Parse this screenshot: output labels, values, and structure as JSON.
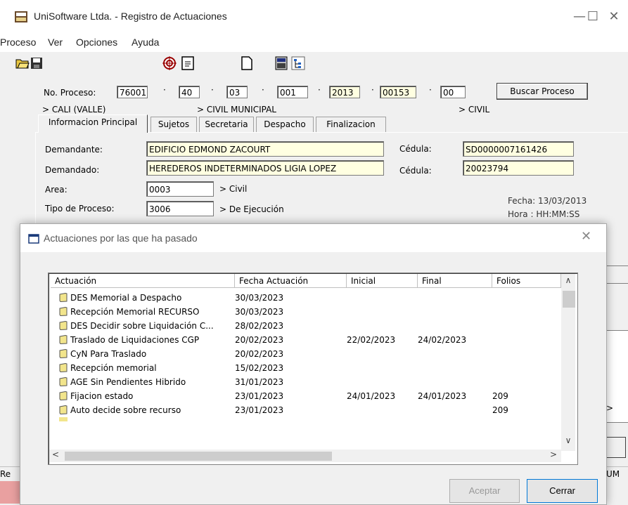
{
  "window": {
    "title": "UniSoftware Ltda. - Registro de Actuaciones",
    "minimize": "—",
    "maximize": "☐",
    "close": "✕"
  },
  "menu": [
    "Proceso",
    "Ver",
    "Opciones",
    "Ayuda"
  ],
  "process": {
    "label": "No. Proceso:",
    "segments": [
      "76001",
      "40",
      "03",
      "001",
      "2013",
      "00153",
      "00"
    ],
    "search_button": "Buscar Proceso",
    "location": "> CALI (VALLE)",
    "court": "> CIVIL MUNICIPAL",
    "speciality": "> CIVIL"
  },
  "tabs": [
    "Informacion Principal",
    "Sujetos",
    "Secretaria",
    "Despacho",
    "Finalizacion"
  ],
  "main": {
    "demandante_label": "Demandante:",
    "demandante": "EDIFICIO EDMOND ZACOURT",
    "cedula_label": "Cédula:",
    "cedula1": "SD0000007161426",
    "demandado_label": "Demandado:",
    "demandado": "HEREDEROS INDETERMINADOS LIGIA LOPEZ",
    "cedula2": "20023794",
    "area_label": "Area:",
    "area": "0003",
    "area_desc": "> Civil",
    "tipo_label": "Tipo de Proceso:",
    "tipo": "3006",
    "tipo_desc": "> De Ejecución",
    "fecha": "Fecha:  13/03/2013",
    "hora": "Hora :  HH:MM:SS"
  },
  "status": {
    "left": "Re",
    "right": "UM"
  },
  "modal": {
    "title": "Actuaciones por las que ha pasado",
    "close": "✕",
    "columns": [
      "Actuación",
      "Fecha Actuación",
      "Inicial",
      "Final",
      "Folios"
    ],
    "rows": [
      [
        "DES Memorial a Despacho",
        "30/03/2023",
        "",
        "",
        ""
      ],
      [
        "Recepción Memorial RECURSO",
        "30/03/2023",
        "",
        "",
        ""
      ],
      [
        "DES Decidir sobre Liquidación C...",
        "28/02/2023",
        "",
        "",
        ""
      ],
      [
        "Traslado de Liquidaciones CGP",
        "20/02/2023",
        "22/02/2023",
        "24/02/2023",
        ""
      ],
      [
        "CyN Para Traslado",
        "20/02/2023",
        "",
        "",
        ""
      ],
      [
        "Recepción memorial",
        "15/02/2023",
        "",
        "",
        ""
      ],
      [
        "AGE Sin Pendientes Hibrido",
        "31/01/2023",
        "",
        "",
        ""
      ],
      [
        "Fijacion estado",
        "23/01/2023",
        "24/01/2023",
        "24/01/2023",
        "209"
      ],
      [
        "Auto decide sobre recurso",
        "23/01/2023",
        "",
        "",
        "209"
      ]
    ],
    "aceptar": "Aceptar",
    "cerrar": "Cerrar"
  },
  "colors": {
    "field_yellow": "#ffffe1",
    "folder": "#f2e58c"
  }
}
